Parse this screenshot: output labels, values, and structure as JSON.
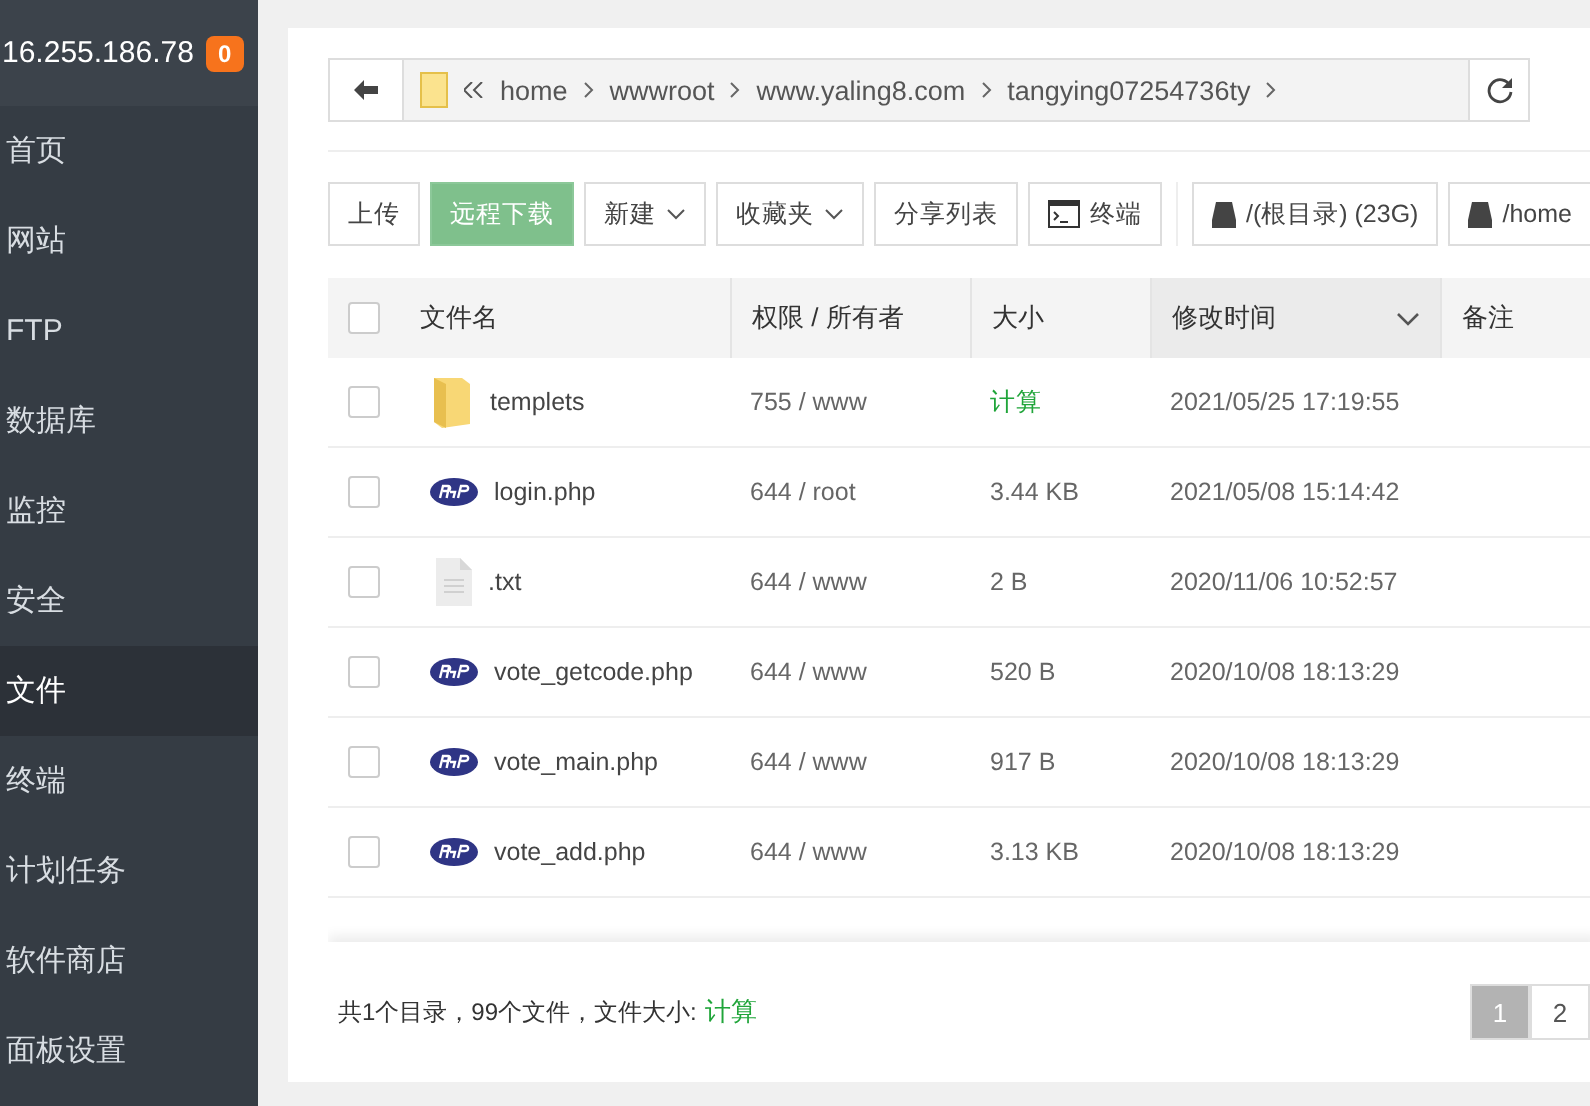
{
  "sidebar": {
    "server": "16.255.186.78",
    "badge": "0",
    "items": [
      {
        "label": "首页",
        "selected": false
      },
      {
        "label": "网站",
        "selected": false
      },
      {
        "label": "FTP",
        "selected": false
      },
      {
        "label": "数据库",
        "selected": false
      },
      {
        "label": "监控",
        "selected": false
      },
      {
        "label": "安全",
        "selected": false
      },
      {
        "label": "文件",
        "selected": true
      },
      {
        "label": "终端",
        "selected": false
      },
      {
        "label": "计划任务",
        "selected": false
      },
      {
        "label": "软件商店",
        "selected": false
      },
      {
        "label": "面板设置",
        "selected": false
      }
    ]
  },
  "breadcrumb": [
    "home",
    "wwwroot",
    "www.yaling8.com",
    "tangying07254736ty"
  ],
  "toolbar": [
    {
      "label": "上传",
      "kind": "plain"
    },
    {
      "label": "远程下载",
      "kind": "disabled"
    },
    {
      "label": "新建",
      "kind": "dropdown"
    },
    {
      "label": "收藏夹",
      "kind": "dropdown"
    },
    {
      "label": "分享列表",
      "kind": "plain"
    },
    {
      "label": "终端",
      "kind": "terminal"
    },
    {
      "label": "/(根目录) (23G)",
      "kind": "disk"
    },
    {
      "label": "/home",
      "kind": "disk"
    }
  ],
  "table": {
    "all_checked": false,
    "columns": [
      {
        "label": "文件名",
        "sorted": false
      },
      {
        "label": "权限 / 所有者",
        "sorted": false
      },
      {
        "label": "大小",
        "sorted": false
      },
      {
        "label": "修改时间",
        "sorted": true
      },
      {
        "label": "备注",
        "sorted": false
      }
    ],
    "rows": [
      {
        "kind": "folder",
        "name": "templets",
        "perm": "755 / www",
        "size": "计算",
        "size_link": true,
        "time": "2021/05/25 17:19:55",
        "checked": false
      },
      {
        "kind": "php",
        "name": "login.php",
        "perm": "644 / root",
        "size": "3.44 KB",
        "size_link": false,
        "time": "2021/05/08 15:14:42",
        "checked": false
      },
      {
        "kind": "text",
        "name": ".txt",
        "perm": "644 / www",
        "size": "2 B",
        "size_link": false,
        "time": "2020/11/06 10:52:57",
        "checked": false
      },
      {
        "kind": "php",
        "name": "vote_getcode.php",
        "perm": "644 / www",
        "size": "520 B",
        "size_link": false,
        "time": "2020/10/08 18:13:29",
        "checked": false
      },
      {
        "kind": "php",
        "name": "vote_main.php",
        "perm": "644 / www",
        "size": "917 B",
        "size_link": false,
        "time": "2020/10/08 18:13:29",
        "checked": false
      },
      {
        "kind": "php",
        "name": "vote_add.php",
        "perm": "644 / www",
        "size": "3.13 KB",
        "size_link": false,
        "time": "2020/10/08 18:13:29",
        "checked": false
      }
    ]
  },
  "footer": {
    "summary": "共1个目录，99个文件，文件大小:",
    "calc": "计算",
    "pages": [
      {
        "label": "1",
        "selected": true
      },
      {
        "label": "2",
        "selected": false
      }
    ]
  }
}
